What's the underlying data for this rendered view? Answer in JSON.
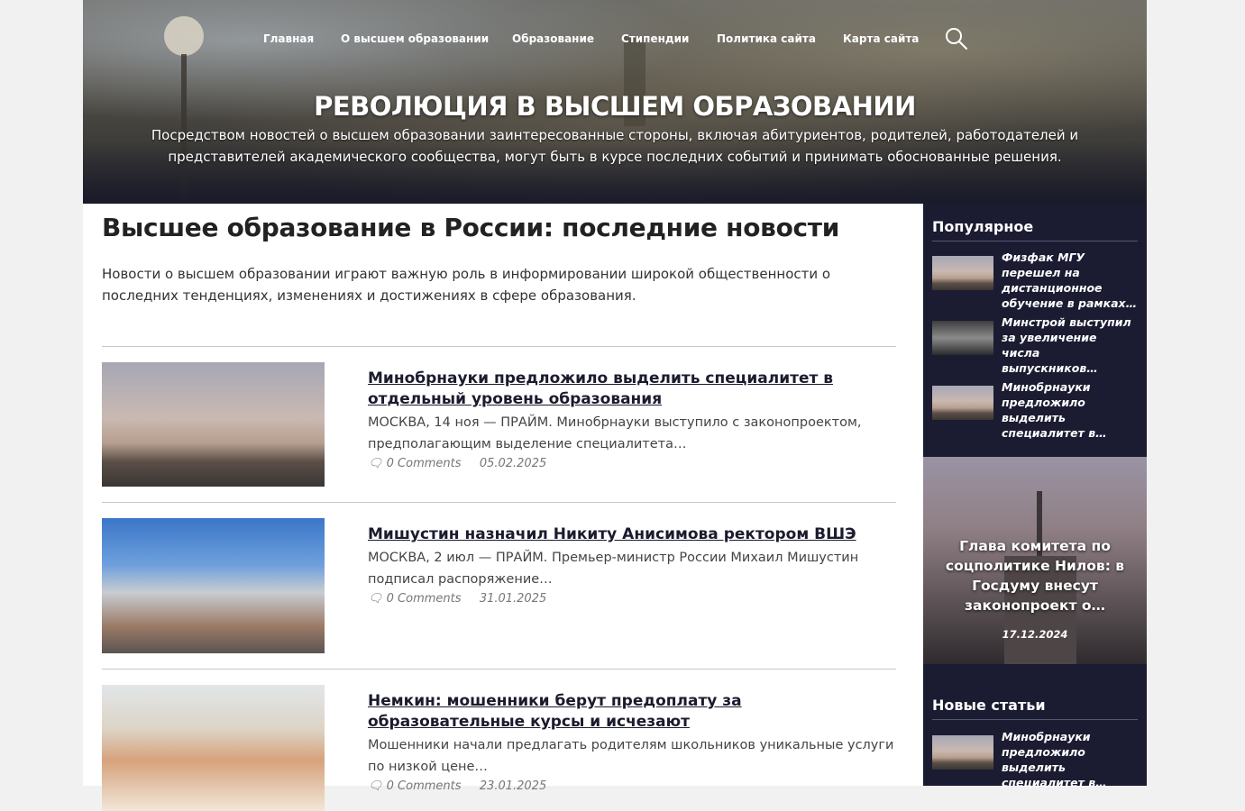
{
  "nav": {
    "items": [
      {
        "label": "Главная"
      },
      {
        "label": "О высшем образовании"
      },
      {
        "label": "Образование"
      },
      {
        "label": "Стипендии"
      },
      {
        "label": "Политика сайта"
      },
      {
        "label": "Карта сайта"
      }
    ],
    "search_icon": "search-icon"
  },
  "hero": {
    "title": "РЕВОЛЮЦИЯ В ВЫСШЕМ ОБРАЗОВАНИИ",
    "description": "Посредством новостей о высшем образовании заинтересованные стороны, включая абитуриентов, родителей, работодателей и представителей академического сообщества, могут быть в курсе последних событий и принимать обоснованные решения."
  },
  "main": {
    "title": "Высшее образование в России: последние новости",
    "intro": "Новости о высшем образовании играют важную роль в информировании широкой общественности о последних тенденциях, изменениях и достижениях в сфере образования.",
    "articles": [
      {
        "title": "Минобрнауки предложило выделить специалитет в отдельный уровень образования",
        "excerpt": "МОСКВА, 14 ноя — ПРАЙМ. Минобрнауки выступило с законопроектом, предполагающим выделение специалитета…",
        "comments": "0 Comments",
        "date": "05.02.2025"
      },
      {
        "title": "Мишустин назначил Никиту Анисимова ректором ВШЭ",
        "excerpt": "МОСКВА, 2 июл — ПРАЙМ. Премьер-министр России Михаил Мишустин подписал распоряжение…",
        "comments": "0 Comments",
        "date": "31.01.2025"
      },
      {
        "title": "Немкин: мошенники берут предоплату за образовательные курсы и исчезают",
        "excerpt": "Мошенники начали предлагать родителям школьников уникальные услуги по низкой цене…",
        "comments": "0 Comments",
        "date": "23.01.2025"
      }
    ]
  },
  "sidebar": {
    "popular_heading": "Популярное",
    "popular": [
      {
        "title": "Физфак МГУ перешел на дистанционное обучение в рамках…"
      },
      {
        "title": "Минстрой выступил за увеличение числа выпускников…"
      },
      {
        "title": "Минобрнауки предложило выделить специалитет в…"
      }
    ],
    "feature": {
      "title": "Глава комитета по соцполитике Нилов: в Госдуму внесут законопроект о…",
      "date": "17.12.2024"
    },
    "new_heading": "Новые статьи",
    "new": [
      {
        "title": "Минобрнауки предложило выделить специалитет в…"
      }
    ]
  },
  "colors": {
    "sidebar_bg": "#1b1b31",
    "accent_text": "#1b1b2e",
    "page_bg": "#f1f1f1"
  }
}
